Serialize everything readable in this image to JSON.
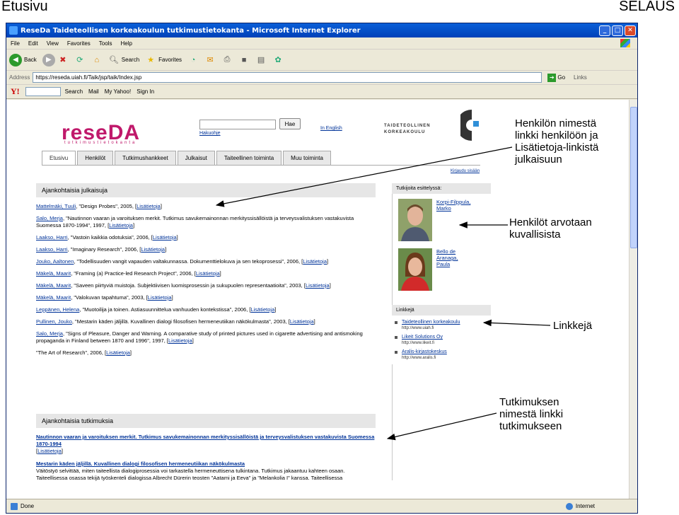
{
  "slide": {
    "title_left": "Etusivu",
    "title_right": "SELAUS"
  },
  "browser": {
    "window_title": "ReseDa Taideteollisen korkeakoulun tutkimustietokanta - Microsoft Internet Explorer",
    "menu": [
      "File",
      "Edit",
      "View",
      "Favorites",
      "Tools",
      "Help"
    ],
    "toolbar": {
      "back": "Back",
      "search": "Search",
      "favorites": "Favorites"
    },
    "address_label": "Address",
    "address": "https://reseda.uiah.fi/Taik/jsp/taik/Index.jsp",
    "go": "Go",
    "links": "Links",
    "yahoo": {
      "logo": "Y!",
      "search": "Search",
      "mail": "Mail",
      "my_yahoo": "My Yahoo!",
      "sign_in": "Sign In"
    },
    "status": "Done",
    "zone": "Internet"
  },
  "site": {
    "logo": "reseDA",
    "logo_sub": "tutkimustietokanta",
    "search_button": "Hae",
    "advanced_search": "Hakuohje",
    "language_link": "In English",
    "university": [
      "TAIDETEOLLINEN",
      "KORKEAKOULU"
    ],
    "tabs": [
      "Etusivu",
      "Henkilöt",
      "Tutkimushankkeet",
      "Julkaisut",
      "Taiteellinen toiminta",
      "Muu toiminta"
    ],
    "logout": "Kirjaudu sisään",
    "pub_heading": "Ajankohtaisia julkaisuja",
    "publications": [
      {
        "author": "Mattelmäki, Tuuli",
        "text": ", \"Design Probes\", 2005, [",
        "link": "Lisätietoja",
        "end": "]"
      },
      {
        "author": "Salo, Merja",
        "text": ", \"Nautinnon vaaran ja varoituksen merkit. Tutkimus savukemainonnan merkityssisällöistä ja terveysvalistuksen vastakuvista Suomessa 1870-1994\", 1997, [",
        "link": "Lisätietoja",
        "end": "]"
      },
      {
        "author": "Laakso, Harri",
        "text": ", \"Vastoin kaikkia odotuksia\", 2006, [",
        "link": "Lisätietoja",
        "end": "]"
      },
      {
        "author": "Laakso, Harri",
        "text": ", \"Imaginary Research\", 2006, [",
        "link": "Lisätietoja",
        "end": "]"
      },
      {
        "author": "Jouko, Aaltonen",
        "text": ", \"Todellisuuden vangit vapauden valtakunnassa. Dokumenttielokuva ja sen tekoprosessi\", 2006, [",
        "link": "Lisätietoja",
        "end": "]"
      },
      {
        "author": "Mäkelä, Maarit",
        "text": ", \"Framing (a) Practice-led Research Project\", 2006, [",
        "link": "Lisätietoja",
        "end": "]"
      },
      {
        "author": "Mäkelä, Maarit",
        "text": ", \"Saveen piirtyviä muistoja. Subjektiivisen luomisprosessin ja sukupuolen representaatioita\", 2003, [",
        "link": "Lisätietoja",
        "end": "]"
      },
      {
        "author": "Mäkelä, Maarit",
        "text": ", \"Valokuvan tapahtuma\", 2003, [",
        "link": "Lisätietoja",
        "end": "]"
      },
      {
        "author": "Leppänen, Helena",
        "text": ", \"Muotoilija ja toinen. Astiasuunnittelua vanhuuden kontekstissa\", 2006, [",
        "link": "Lisätietoja",
        "end": "]"
      },
      {
        "author": "Pullinen, Jouko",
        "text": ", \"Mestarin käden jäljillä. Kuvallinen dialogi filosofisen hermeneutiikan näkökulmasta\", 2003, [",
        "link": "Lisätietoja",
        "end": "]"
      },
      {
        "author": "Salo, Merja",
        "text": ", \"Signs of Pleasure, Danger and Warning. A comparative study of printed pictures used in cigarette advertising and antismoking propaganda in Finland between 1870 and 1996\", 1997, [",
        "link": "Lisätietoja",
        "end": "]"
      },
      {
        "author": "",
        "text": "\"The Art of Research\", 2006, [",
        "link": "Lisätietoja",
        "end": "]"
      }
    ],
    "res_heading": "Ajankohtaisia tutkimuksia",
    "research": [
      {
        "title": "Nautinnon vaaran ja varoituksen merkit. Tutkimus savukemainonnan merkityssisällöistä ja terveysvalistuksen vastakuvista Suomessa 1870-1994",
        "desc": "",
        "link": "Lisätietoja"
      },
      {
        "title": "Mestarin käden jäljillä. Kuvallinen dialogi filosofisen hermeneutiikan näkökulmasta",
        "desc": "Väitöstyö selvittää, miten taiteellista dialogiprosessia voi tarkastella hermeneuttisena tulkintana. Tutkimus jakaantuu kahteen osaan. Taiteellisessa osassa tekijä työskenteli dialogissa Albrecht Dürerin teosten \"Aatami ja Eeva\" ja \"Melankolia I\" kanssa. Taiteellisessa",
        "link": ""
      }
    ],
    "featured_heading": "Tutkijoita esittelyssä:",
    "featured": [
      {
        "name_lines": [
          "Korpi-Filppula,",
          "Marko"
        ]
      },
      {
        "name_lines": [
          "Bello de",
          "Aranaga,",
          "Paula"
        ]
      }
    ],
    "links_heading": "Linkkejä",
    "links": [
      {
        "name": "Taideteollinen korkeakoulu",
        "url": "http://www.uiah.fi"
      },
      {
        "name": "Likeit Solutions Oy",
        "url": "http://www.likeit.fi"
      },
      {
        "name": "Aralis-kirjastokeskus",
        "url": "http://www.aralis.fi"
      }
    ]
  },
  "annotations": {
    "a1": [
      "Henkilön nimestä",
      "linkki henkilöön ja",
      "Lisätietoja-linkistä",
      "julkaisuun"
    ],
    "a2": [
      "Henkilöt arvotaan",
      "kuvallisista"
    ],
    "a3": [
      "Linkkejä"
    ],
    "a4": [
      "Tutkimuksen",
      "nimestä linkki",
      "tutkimukseen"
    ]
  }
}
